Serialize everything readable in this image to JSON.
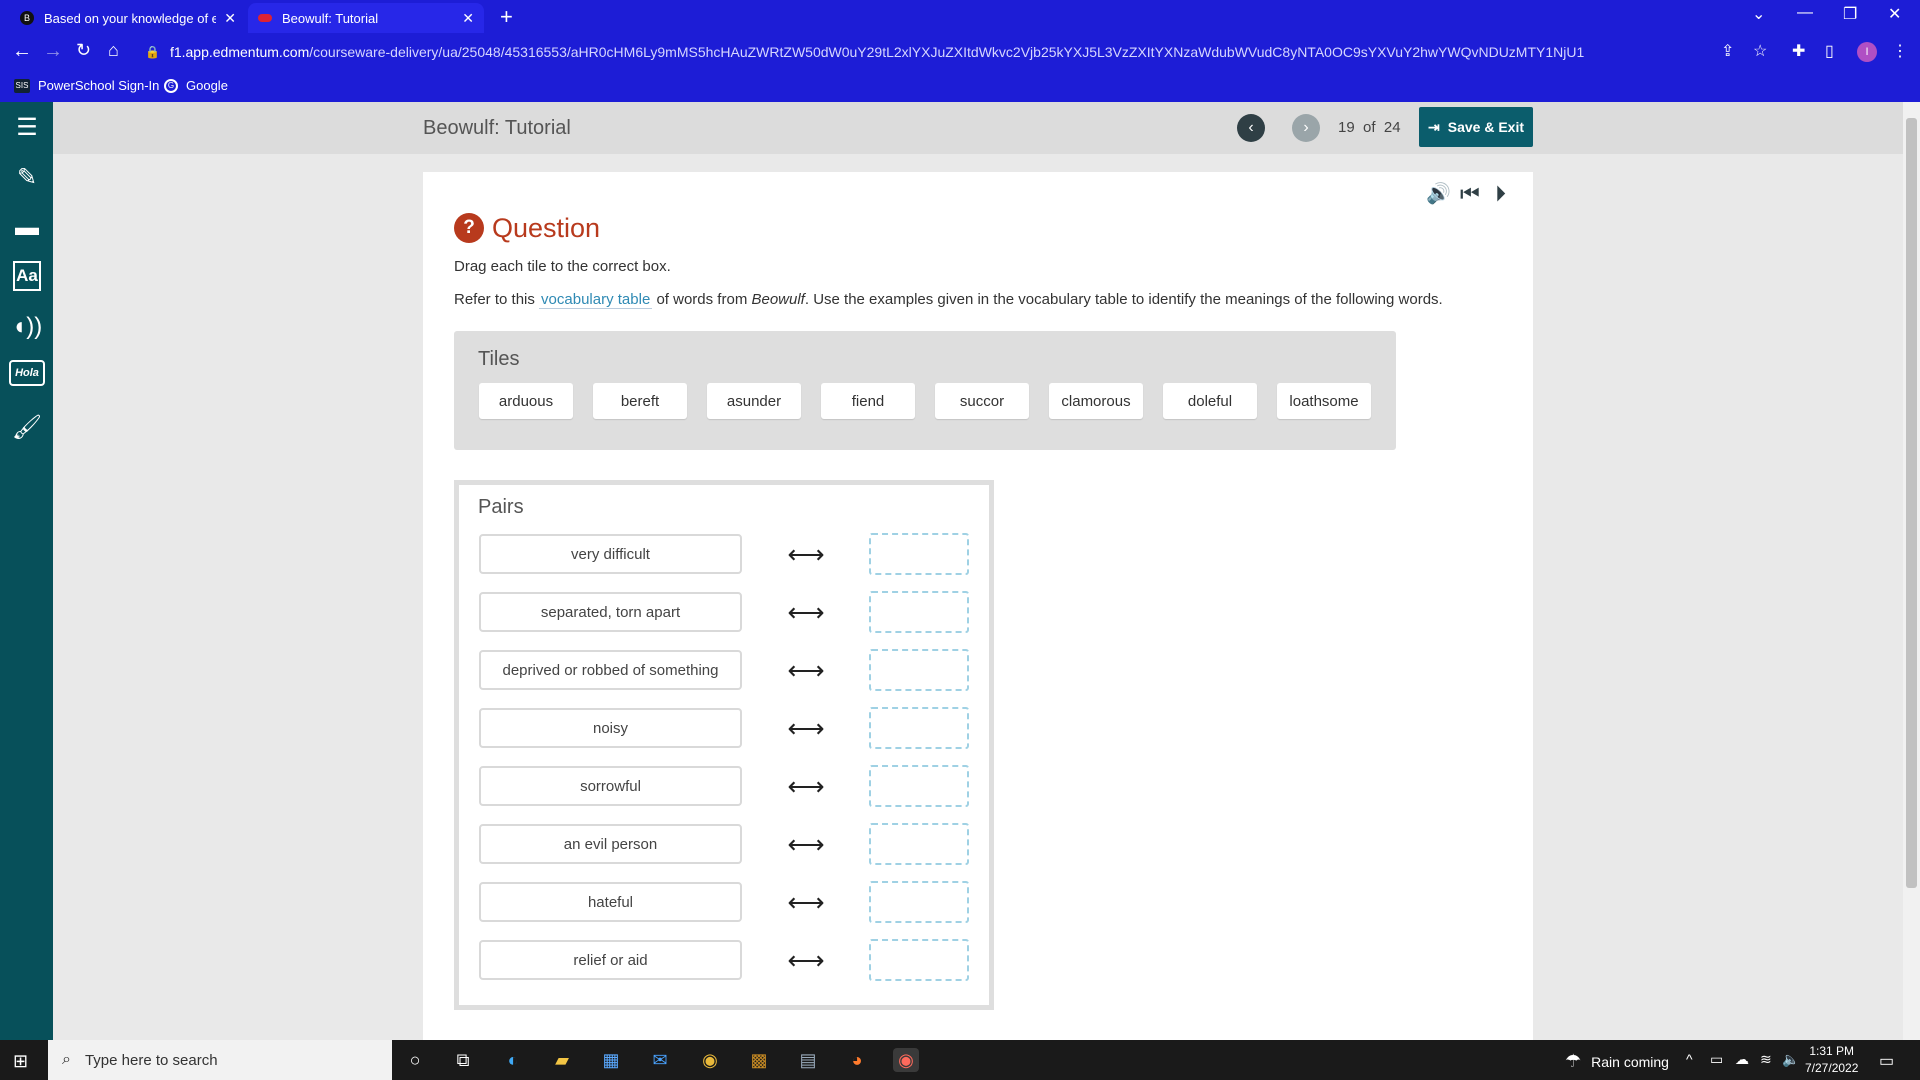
{
  "browser": {
    "tabs": [
      {
        "title": "Based on your knowledge of epi",
        "favicon": "B"
      },
      {
        "title": "Beowulf: Tutorial"
      }
    ],
    "url_host": "f1.app.edmentum.com",
    "url_path": "/courseware-delivery/ua/25048/45316553/aHR0cHM6Ly9mMS5hcHAuZWRtZW50dW0uY29tL2xlYXJuZXItdWkvc2Vjb25kYXJ5L3VzZXItYXNzaWdubWVudC8yNTA0OC9sYXVuY2hwYWQvNDUzMTY1NjU1",
    "bookmarks": [
      {
        "label": "PowerSchool Sign-In",
        "icon_text": "SIS"
      },
      {
        "label": "Google"
      }
    ],
    "profile_initial": "I"
  },
  "header": {
    "course_title": "Beowulf: Tutorial",
    "page_current": "19",
    "page_of": "of",
    "page_total": "24",
    "save_label": "Save & Exit"
  },
  "question": {
    "title": "Question",
    "icon": "?",
    "instruction": "Drag each tile to the correct box.",
    "refer_pre": "Refer to this",
    "refer_link": "vocabulary table",
    "refer_mid": "of words from",
    "refer_italic": "Beowulf",
    "refer_post": ". Use the examples given in the vocabulary table to identify the meanings of the following words."
  },
  "tiles": {
    "heading": "Tiles",
    "items": [
      "arduous",
      "bereft",
      "asunder",
      "fiend",
      "succor",
      "clamorous",
      "doleful",
      "loathsome"
    ]
  },
  "pairs": {
    "heading": "Pairs",
    "items": [
      "very difficult",
      "separated, torn apart",
      "deprived or robbed of something",
      "noisy",
      "sorrowful",
      "an evil person",
      "hateful",
      "relief or aid"
    ]
  },
  "taskbar": {
    "search_placeholder": "Type here to search",
    "weather": "Rain coming",
    "time": "1:31 PM",
    "date": "7/27/2022"
  },
  "colors": {
    "browser_chrome": "#1d1dd6",
    "sidebar": "#07505a",
    "accent": "#0b5d6c",
    "question": "#b83a1d",
    "link": "#2f8ab4"
  }
}
